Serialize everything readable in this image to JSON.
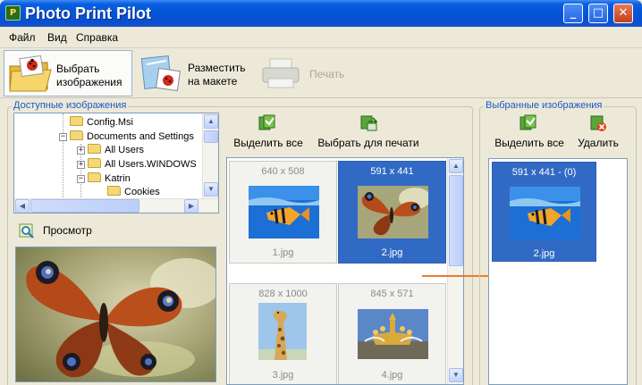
{
  "window": {
    "title": "Photo Print Pilot",
    "minimize": "_",
    "maximize": "□",
    "close": "✕",
    "app_icon": "P"
  },
  "menu": [
    "Файл",
    "Вид",
    "Справка"
  ],
  "toolbar": {
    "select_images": [
      "Выбрать",
      "изображения"
    ],
    "place_on_layout": [
      "Разместить",
      "на макете"
    ],
    "print": "Печать"
  },
  "available": {
    "title": "Доступные изображения",
    "tree": [
      {
        "label": "Config.Msi",
        "indent": 0,
        "expander": ""
      },
      {
        "label": "Documents and Settings",
        "indent": 0,
        "expander": "−"
      },
      {
        "label": "All Users",
        "indent": 1,
        "expander": "+"
      },
      {
        "label": "All Users.WINDOWS",
        "indent": 1,
        "expander": "+"
      },
      {
        "label": "Katrin",
        "indent": 1,
        "expander": "−"
      },
      {
        "label": "Cookies",
        "indent": 2,
        "expander": ""
      }
    ],
    "preview_label": "Просмотр",
    "select_all": "Выделить все",
    "select_for_print": "Выбрать для печати",
    "images": [
      {
        "dims": "640 x 508",
        "file": "1.jpg",
        "selected": false,
        "kind": "fish"
      },
      {
        "dims": "591 x 441",
        "file": "2.jpg",
        "selected": true,
        "kind": "butterfly"
      },
      {
        "dims": "828 x 1000",
        "file": "3.jpg",
        "selected": false,
        "kind": "giraffe"
      },
      {
        "dims": "845 x 571",
        "file": "4.jpg",
        "selected": false,
        "kind": "fountain"
      }
    ]
  },
  "selected": {
    "title": "Выбранные изображения",
    "select_all": "Выделить все",
    "delete": "Удалить",
    "images": [
      {
        "dims": "591 x 441 - (0)",
        "file": "2.jpg",
        "kind": "fish"
      }
    ]
  },
  "colors": {
    "accent": "#316ac5",
    "group_title": "#1e56c8",
    "arrow": "#f07a2a"
  }
}
